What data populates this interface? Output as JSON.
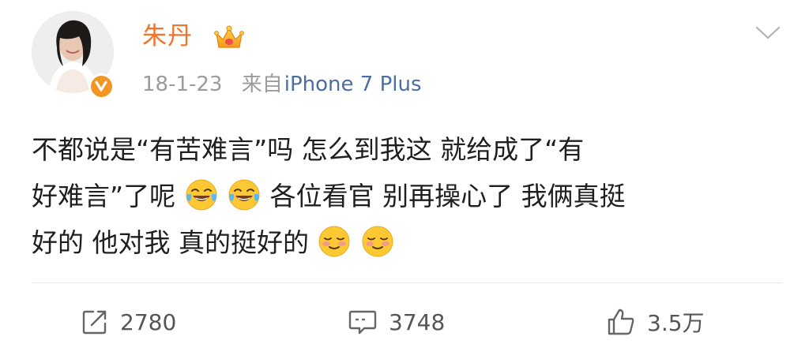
{
  "author": {
    "name": "朱丹",
    "verified": true,
    "avatar_icon": "profile-photo",
    "badge_icon": "crown-icon",
    "name_color": "#f4722c"
  },
  "meta": {
    "date": "18-1-23",
    "via_label": "来自",
    "source": "iPhone 7 Plus"
  },
  "content": {
    "lines": [
      {
        "text": "不都说是“有苦难言”吗  怎么到我这  就给成了“有",
        "emoji_after": []
      },
      {
        "text": "好难言”了呢",
        "emoji_after": [
          "laugh-cry",
          "laugh-cry"
        ],
        "tail": "各位看官  别再操心了  我俩真挺"
      },
      {
        "text": "好的 他对我 真的挺好的",
        "emoji_after": [
          "shy",
          "shy"
        ]
      }
    ]
  },
  "actions": {
    "repost": {
      "icon": "repost-icon",
      "count": "2780"
    },
    "comment": {
      "icon": "comment-icon",
      "count": "3748"
    },
    "like": {
      "icon": "thumbs-up-icon",
      "count": "3.5万"
    }
  },
  "colors": {
    "text": "#1f1f1f",
    "meta": "#9b9b9b",
    "link": "#4a6fa4",
    "verified": "#f39523"
  }
}
